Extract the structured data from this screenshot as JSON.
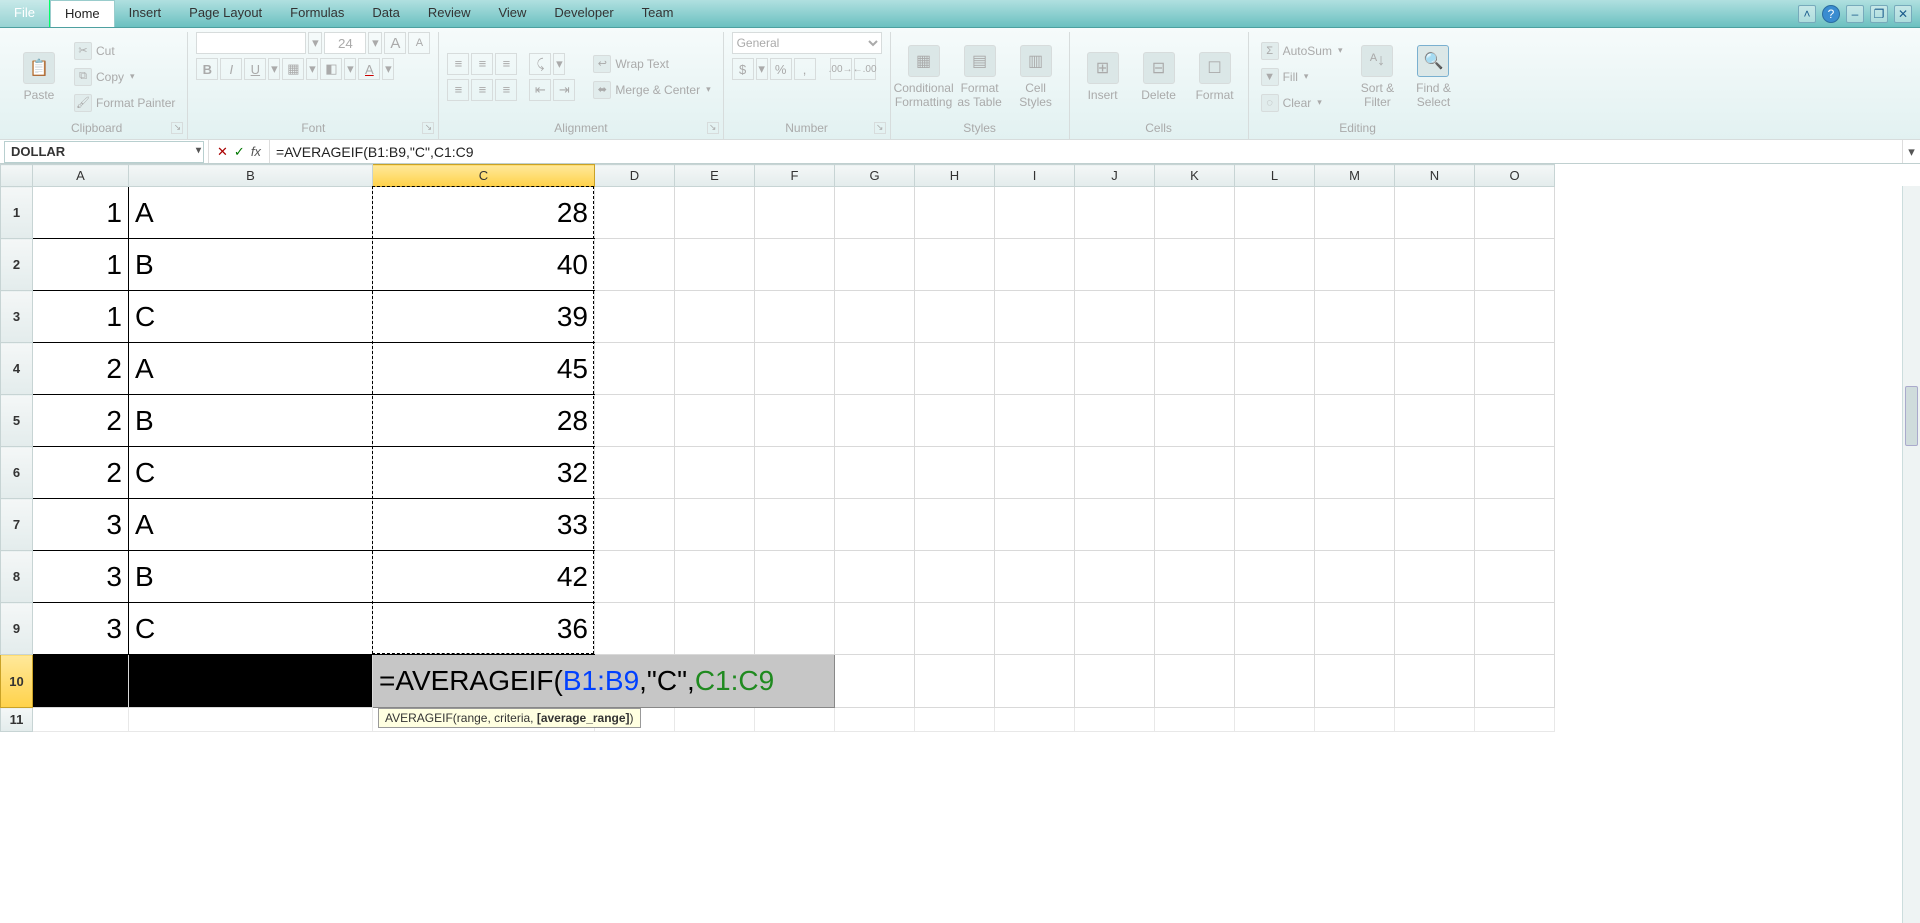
{
  "tabs": {
    "file": "File",
    "home": "Home",
    "insert": "Insert",
    "pagelayout": "Page Layout",
    "formulas": "Formulas",
    "data": "Data",
    "review": "Review",
    "view": "View",
    "developer": "Developer",
    "team": "Team"
  },
  "ribbon": {
    "clipboard": {
      "paste": "Paste",
      "cut": "Cut",
      "copy": "Copy",
      "formatpainter": "Format Painter",
      "label": "Clipboard"
    },
    "font": {
      "size": "24",
      "bold": "B",
      "italic": "I",
      "underline": "U",
      "label": "Font"
    },
    "alignment": {
      "wraptext": "Wrap Text",
      "merge": "Merge & Center",
      "label": "Alignment"
    },
    "number": {
      "format": "General",
      "label": "Number"
    },
    "styles": {
      "cond": "Conditional",
      "cond2": "Formatting",
      "table": "Format",
      "table2": "as Table",
      "cell": "Cell",
      "cell2": "Styles",
      "label": "Styles"
    },
    "cells": {
      "insert": "Insert",
      "delete": "Delete",
      "format": "Format",
      "label": "Cells"
    },
    "editing": {
      "autosum": "AutoSum",
      "fill": "Fill",
      "clear": "Clear",
      "sort": "Sort &",
      "sort2": "Filter",
      "find": "Find &",
      "find2": "Select",
      "label": "Editing"
    }
  },
  "namebox": "DOLLAR",
  "formula": "=AVERAGEIF(B1:B9,\"C\",C1:C9",
  "columns": [
    "A",
    "B",
    "C",
    "D",
    "E",
    "F",
    "G",
    "H",
    "I",
    "J",
    "K",
    "L",
    "M",
    "N",
    "O"
  ],
  "rows": [
    {
      "A": "1",
      "B": "A",
      "C": "28"
    },
    {
      "A": "1",
      "B": "B",
      "C": "40"
    },
    {
      "A": "1",
      "B": "C",
      "C": "39"
    },
    {
      "A": "2",
      "B": "A",
      "C": "45"
    },
    {
      "A": "2",
      "B": "B",
      "C": "28"
    },
    {
      "A": "2",
      "B": "C",
      "C": "32"
    },
    {
      "A": "3",
      "B": "A",
      "C": "33"
    },
    {
      "A": "3",
      "B": "B",
      "C": "42"
    },
    {
      "A": "3",
      "B": "C",
      "C": "36"
    }
  ],
  "editcell": {
    "pre": "=AVERAGEIF(",
    "ref1": "B1:B9",
    "mid": ",\"C\",",
    "ref2": "C1:C9"
  },
  "tooltip": "AVERAGEIF(range, criteria, [average_range])",
  "tooltip_bold": "[average_range]",
  "colwidths": {
    "rowhdr": 32,
    "A": 96,
    "B": 244,
    "C": 222,
    "other": 80
  },
  "extra_rows": [
    "11"
  ]
}
